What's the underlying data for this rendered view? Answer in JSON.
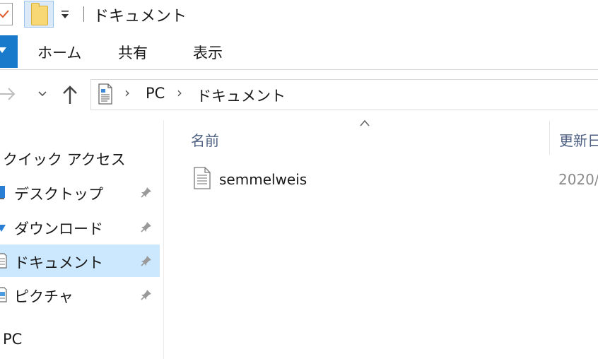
{
  "window": {
    "title": "ドキュメント"
  },
  "ribbon": {
    "tabs": [
      "ホーム",
      "共有",
      "表示"
    ]
  },
  "address": {
    "crumbs": [
      "PC",
      "ドキュメント"
    ]
  },
  "nav": {
    "quick_access": "クイック アクセス",
    "items": [
      {
        "label": "デスクトップ",
        "pinned": true,
        "selected": false
      },
      {
        "label": "ダウンロード",
        "pinned": true,
        "selected": false
      },
      {
        "label": "ドキュメント",
        "pinned": true,
        "selected": true
      },
      {
        "label": "ピクチャ",
        "pinned": true,
        "selected": false
      }
    ],
    "pc": "PC"
  },
  "content": {
    "columns": {
      "name": "名前",
      "modified": "更新日"
    },
    "files": [
      {
        "name": "semmelweis",
        "modified": "2020/"
      }
    ]
  },
  "colors": {
    "accent": "#1979ca",
    "selected_bg": "#cce8ff",
    "header_text": "#4d6082"
  }
}
